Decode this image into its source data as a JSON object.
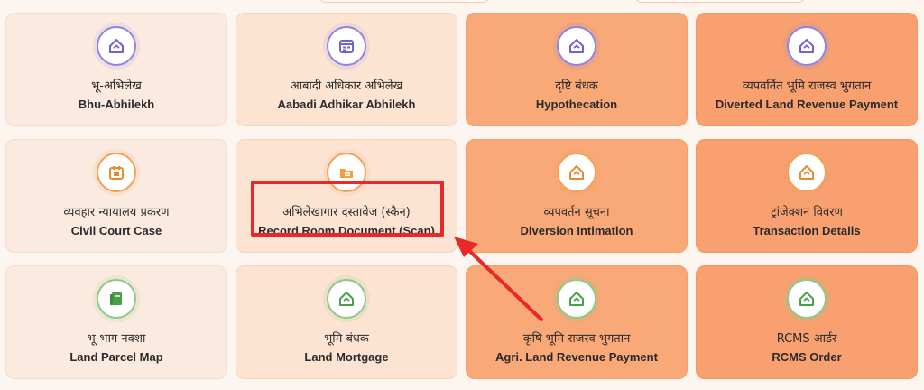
{
  "colors": {
    "highlight": "#e8282b",
    "icon_purple": "#6d62d6",
    "icon_orange": "#e88a2e",
    "icon_green": "#4aa04a"
  },
  "cards": [
    {
      "hindi": "भू-अभिलेख",
      "english": "Bhu-Abhilekh",
      "icon": "home-icon"
    },
    {
      "hindi": "आबादी अधिकार अभिलेख",
      "english": "Aabadi Adhikar Abhilekh",
      "icon": "calendar-icon"
    },
    {
      "hindi": "दृष्टि बंधक",
      "english": "Hypothecation",
      "icon": "home-icon"
    },
    {
      "hindi": "व्यपवर्तित भूमि राजस्व भुगतान",
      "english": "Diverted Land Revenue Payment",
      "icon": "home-icon"
    },
    {
      "hindi": "व्यवहार न्यायालय प्रकरण",
      "english": "Civil Court Case",
      "icon": "calendar-icon"
    },
    {
      "hindi": "अभिलेखागार दस्तावेज (स्कैन)",
      "english": "Record Room Document (Scan)",
      "icon": "folder-icon"
    },
    {
      "hindi": "व्यपवर्तन सूचना",
      "english": "Diversion Intimation",
      "icon": "home-icon"
    },
    {
      "hindi": "ट्रांजेक्शन विवरण",
      "english": "Transaction Details",
      "icon": "home-icon"
    },
    {
      "hindi": "भू-भाग नक्शा",
      "english": "Land Parcel Map",
      "icon": "book-icon"
    },
    {
      "hindi": "भूमि बंधक",
      "english": "Land Mortgage",
      "icon": "home-icon"
    },
    {
      "hindi": "कृषि भूमि राजस्व भुगतान",
      "english": "Agri. Land Revenue Payment",
      "icon": "home-icon"
    },
    {
      "hindi": "RCMS आर्डर",
      "english": "RCMS Order",
      "icon": "home-icon"
    }
  ]
}
